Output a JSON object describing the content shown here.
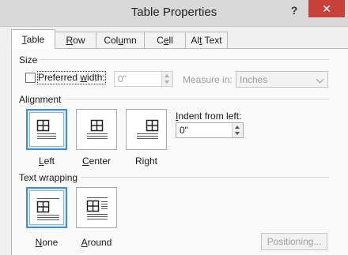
{
  "window": {
    "title": "Table Properties",
    "help": "?",
    "close": "✕"
  },
  "tabs": [
    {
      "label": "Table",
      "u": "T",
      "rest": "able",
      "active": true
    },
    {
      "label": "Row",
      "u": "R",
      "rest": "ow"
    },
    {
      "label": "Column",
      "pre": "Col",
      "u": "u",
      "rest": "mn"
    },
    {
      "label": "Cell",
      "u": "C",
      "pre2": "",
      "rest": "ell",
      "under_e": true
    },
    {
      "label": "Alt Text",
      "pre": "Al",
      "u": "t",
      "rest": " Text"
    }
  ],
  "size": {
    "section_label": "Size",
    "preferred_width_label": "Preferred width:",
    "preferred_width_checked": false,
    "width_value": "0\"",
    "measure_label": "Measure in:",
    "measure_value": "Inches"
  },
  "alignment": {
    "section_label": "Alignment",
    "options": [
      {
        "label": "Left",
        "u": "L",
        "rest": "eft",
        "selected": true
      },
      {
        "label": "Center",
        "u": "C",
        "rest": "enter",
        "selected": false
      },
      {
        "label": "Right",
        "pre": "Ri",
        "u": "g",
        "rest": "ht",
        "selected": false
      }
    ],
    "indent_label": "Indent from left:",
    "indent_value": "0\""
  },
  "wrapping": {
    "section_label": "Text wrapping",
    "options": [
      {
        "label": "None",
        "u": "N",
        "rest": "one",
        "selected": true
      },
      {
        "label": "Around",
        "u": "A",
        "rest": "round",
        "selected": false
      }
    ]
  },
  "buttons": {
    "positioning": "Positioning..."
  },
  "colors": {
    "accent": "#3c8fd6",
    "close": "#c7413a"
  }
}
